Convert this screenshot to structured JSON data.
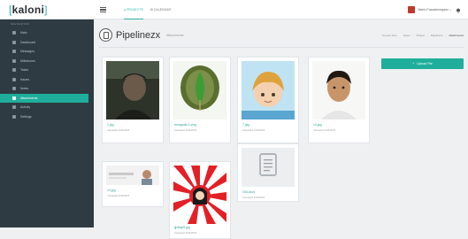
{
  "app": {
    "logo_text": "kaloni"
  },
  "topbar": {
    "tabs": [
      {
        "label": "● PROJECTS"
      },
      {
        "label": "⊞ CALENDAR"
      }
    ],
    "user_name": "Mario Pazaaheregann ⌄"
  },
  "sidebar": {
    "heading": "NAVIGATION",
    "items": [
      {
        "label": "Main",
        "active": false
      },
      {
        "label": "Dashboard",
        "active": false
      },
      {
        "label": "Messages",
        "active": false
      },
      {
        "label": "Milestones",
        "active": false
      },
      {
        "label": "Tasks",
        "active": false
      },
      {
        "label": "Issues",
        "active": false
      },
      {
        "label": "Notes",
        "active": false
      },
      {
        "label": "Attachments",
        "active": true
      },
      {
        "label": "Activity",
        "active": false
      },
      {
        "label": "Settings",
        "active": false
      }
    ]
  },
  "page": {
    "title": "Pipelinezx",
    "subtitle": "Attachments",
    "breadcrumb": [
      "You are here",
      "Home",
      "Project",
      "Pipelinezx",
      "Attachments"
    ],
    "upload_label": "Upload File"
  },
  "files": [
    {
      "name": "1.jpg",
      "meta": "Uploaded 2/20/2015",
      "thumb": "photo-dark-person"
    },
    {
      "name": "mongodb-1.png",
      "meta": "Uploaded 2/20/2015",
      "thumb": "mongodb-leaf-logo"
    },
    {
      "name": "7.jpg",
      "meta": "Uploaded 2/20/2015",
      "thumb": "anime-illustration"
    },
    {
      "name": "12.jpg",
      "meta": "Uploaded 2/20/2015",
      "thumb": "photo-portrait"
    },
    {
      "name": "14.jpg",
      "meta": "Uploaded 2/20/2015",
      "thumb": "photo-document-strip"
    },
    {
      "name": "ijp3uip5.jpg",
      "meta": "Uploaded 2/20/2015",
      "thumb": "rising-sun-poster"
    },
    {
      "name": "000.docx",
      "meta": "Uploaded 2/20/2015",
      "thumb": "file-document-icon"
    }
  ],
  "colors": {
    "accent": "#1fae9c",
    "sidebar_bg": "#2f3b43",
    "page_bg": "#eef0f2"
  }
}
